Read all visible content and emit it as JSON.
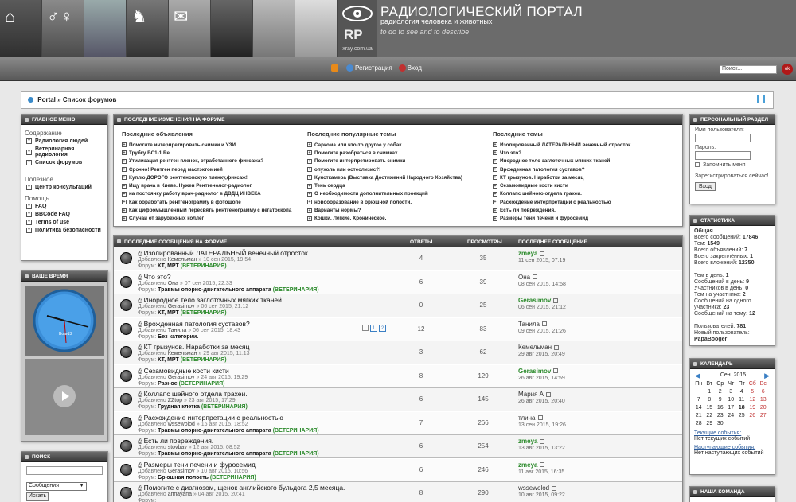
{
  "header": {
    "title": "РАДИОЛОГИЧЕСКИЙ ПОРТАЛ",
    "subtitle": "радиология человека и животных",
    "motto": "to do to see and to describe",
    "logo_text": "RP",
    "logo_url": "xray.com.ua"
  },
  "navbar": {
    "register": "Регистрация",
    "login": "Вход",
    "search_placeholder": "Поиск...",
    "search_button": "ok"
  },
  "breadcrumb": {
    "portal": "Portal",
    "sep": "»",
    "current": "Список форумов"
  },
  "left_menu": {
    "title": "ГЛАВНОЕ МЕНЮ",
    "sections": [
      {
        "head": "Содержание",
        "items": [
          "Радиология людей",
          "Ветеринарная радиология",
          "Список форумов"
        ]
      },
      {
        "head": "Полезное",
        "items": [
          "Центр консультаций"
        ]
      },
      {
        "head": "Помощь",
        "items": [
          "FAQ",
          "BBCode FAQ",
          "Terms of use",
          "Политика безопасности"
        ]
      }
    ]
  },
  "time_panel": {
    "title": "ВАШЕ ВРЕМЯ",
    "clock_brand": "Board3"
  },
  "search_panel": {
    "title": "ПОИСК",
    "select_value": "Сообщения",
    "button": "Искать"
  },
  "recent": {
    "title": "ПОСЛЕДНИЕ ИЗМЕНЕНИЯ НА ФОРУМЕ",
    "columns": [
      {
        "head": "Последние объявления",
        "items": [
          "Помогите интерпретировать снимки и УЗИ.",
          "Трубку БС1-1 Re",
          "Утилизация рентген пленок, отработанного фиксажа?",
          "Срочно! Рентген перед мастэктомией",
          "Куплю ДОРОГО рентгеновскую пленку,фиксаж!",
          "Ищу врача в Киеве. Нужен Рентгенолог-радиолог.",
          "на постоянку работу врач-радиолог в ДВДЦ ИНВЕКА",
          "Как обработать рентгенограмму в фотошопе",
          "Как цифромышленный пересвять рентгенограмму с негатоскопа",
          "Случаи от зарубежных коллег"
        ]
      },
      {
        "head": "Последние популярные темы",
        "items": [
          "Саркома или что-то другое у собак.",
          "Помогите разобраться в снимках",
          "Помогите интерпретировать снимки",
          "опухоль или остеолизис?!",
          "Кунсткамера (Выставка Достижений Народного Хозяйства)",
          "Тень сердца",
          "О необходимости дополнительных проекций",
          "новообразование в брюшной полости.",
          "Варианты нормы?",
          "Кошки. Лёгкие. Хроническое."
        ]
      },
      {
        "head": "Последние темы",
        "items": [
          "Изолированный ЛАТЕРАЛЬНЫЙ венечный отросток",
          "Что это?",
          "Инородное тело заглоточных мягких тканей",
          "Врожденная патология суставов?",
          "КТ грызунов. Наработки за месяц",
          "Сезамовидные кости кисти",
          "Коллапс шейного отдела трахеи.",
          "Расхождение интерпретации с реальностью",
          "Есть ли повреждения.",
          "Размеры тени печени и фуросемид"
        ]
      }
    ]
  },
  "messages": {
    "title": "ПОСЛЕДНИЕ СООБЩЕНИЯ НА ФОРУМЕ",
    "col_replies": "ОТВЕТЫ",
    "col_views": "ПРОСМОТРЫ",
    "col_last": "ПОСЛЕДНЕЕ СООБЩЕНИЕ",
    "rows": [
      {
        "topic": "Изолированный ЛАТЕРАЛЬНЫЙ венечный отросток",
        "added": "Добавлено",
        "author": "Кемельман",
        "date": "» 10 сен 2015, 19:54",
        "forum_label": "Форум:",
        "forum": "КТ, МРТ",
        "tag": "(ВЕТЕРИНАРИЯ)",
        "replies": "4",
        "views": "35",
        "last_user": "zmeya",
        "last_green": true,
        "last_date": "11 сен 2015, 07:19"
      },
      {
        "topic": "Что это?",
        "added": "Добавлено",
        "author": "Она",
        "date": "» 07 сен 2015, 22:33",
        "forum_label": "Форум:",
        "forum": "Травмы опорно-двигательного аппарата",
        "tag": "(ВЕТЕРИНАРИЯ)",
        "replies": "6",
        "views": "39",
        "last_user": "Она",
        "last_green": false,
        "last_date": "08 сен 2015, 14:58"
      },
      {
        "topic": "Инородное тело заглоточных мягких тканей",
        "added": "Добавлено",
        "author": "Gerasimov",
        "date": "» 06 сен 2015, 21:12",
        "forum_label": "Форум:",
        "forum": "КТ, МРТ",
        "tag": "(ВЕТЕРИНАРИЯ)",
        "replies": "0",
        "views": "25",
        "last_user": "Gerasimov",
        "last_green": true,
        "last_date": "06 сен 2015, 21:12"
      },
      {
        "topic": "Врожденная патология суставов?",
        "added": "Добавлено",
        "author": "Танила",
        "date": "» 06 сен 2015, 18:43",
        "forum_label": "Форум:",
        "forum": "Без категории.",
        "tag": "",
        "replies": "12",
        "views": "83",
        "last_user": "Танила",
        "last_green": false,
        "last_date": "09 сен 2015, 21:26",
        "pages": [
          "1",
          "2"
        ]
      },
      {
        "topic": "КТ грызунов. Наработки за месяц",
        "added": "Добавлено",
        "author": "Кемельман",
        "date": "» 29 авг 2015, 11:13",
        "forum_label": "Форум:",
        "forum": "КТ, МРТ",
        "tag": "(ВЕТЕРИНАРИЯ)",
        "replies": "3",
        "views": "62",
        "last_user": "Кемельман",
        "last_green": false,
        "last_date": "29 авг 2015, 20:49"
      },
      {
        "topic": "Сезамовидные кости кисти",
        "added": "Добавлено",
        "author": "Gerasimov",
        "date": "» 24 авг 2015, 19:29",
        "forum_label": "Форум:",
        "forum": "Разное",
        "tag": "(ВЕТЕРИНАРИЯ)",
        "replies": "8",
        "views": "129",
        "last_user": "Gerasimov",
        "last_green": true,
        "last_date": "26 авг 2015, 14:59"
      },
      {
        "topic": "Коллапс шейного отдела трахеи.",
        "added": "Добавлено",
        "author": "ZZtop",
        "date": "» 23 авг 2015, 17:29",
        "forum_label": "Форум:",
        "forum": "Грудная клетка",
        "tag": "(ВЕТЕРИНАРИЯ)",
        "replies": "6",
        "views": "145",
        "last_user": "Мария А",
        "last_green": false,
        "last_date": "26 авг 2015, 20:40"
      },
      {
        "topic": "Расхождение интерпретации с реальностью",
        "added": "Добавлено",
        "author": "wssewolod",
        "date": "» 16 авг 2015, 18:52",
        "forum_label": "Форум:",
        "forum": "Травмы опорно-двигательного аппарата",
        "tag": "(ВЕТЕРИНАРИЯ)",
        "replies": "7",
        "views": "266",
        "last_user": "тлина",
        "last_green": false,
        "last_date": "13 сен 2015, 19:26"
      },
      {
        "topic": "Есть ли повреждения.",
        "added": "Добавлено",
        "author": "stovbav",
        "date": "» 12 авг 2015, 08:52",
        "forum_label": "Форум:",
        "forum": "Травмы опорно-двигательного аппарата",
        "tag": "(ВЕТЕРИНАРИЯ)",
        "replies": "6",
        "views": "254",
        "last_user": "zmeya",
        "last_green": true,
        "last_date": "13 авг 2015, 13:22"
      },
      {
        "topic": "Размеры тени печени и фуросемид",
        "added": "Добавлено",
        "author": "Gerasimov",
        "date": "» 10 авг 2015, 10:56",
        "forum_label": "Форум:",
        "forum": "Брюшная полость",
        "tag": "(ВЕТЕРИНАРИЯ)",
        "replies": "6",
        "views": "246",
        "last_user": "zmeya",
        "last_green": true,
        "last_date": "11 авг 2015, 16:35"
      },
      {
        "topic": "Помогите с диагнозом, щенок английского бульдога 2,5 месяца.",
        "added": "Добавлено",
        "author": "аппауапа",
        "date": "» 04 авг 2015, 20:41",
        "forum_label": "Форум:",
        "forum": "",
        "tag": "",
        "replies": "8",
        "views": "290",
        "last_user": "wssewolod",
        "last_green": false,
        "last_date": "10 авг 2015, 09:22"
      }
    ]
  },
  "personal": {
    "title": "ПЕРСОНАЛЬНЫЙ РАЗДЕЛ",
    "user_label": "Имя пользователя:",
    "pass_label": "Пароль:",
    "remember": "Запомнить меня",
    "register_link": "Зарегистрироваться сейчас!",
    "login_button": "Вход"
  },
  "stats": {
    "title": "СТАТИСТИКА",
    "general_head": "Общая",
    "lines1": [
      [
        "Всего сообщений: ",
        "17846"
      ],
      [
        "Тем: ",
        "1549"
      ],
      [
        "Всего объявлений: ",
        "7"
      ],
      [
        "Всего закреплённых: ",
        "1"
      ],
      [
        "Всего вложений: ",
        "12350"
      ]
    ],
    "lines2": [
      [
        "Тем в день: ",
        "1"
      ],
      [
        "Сообщений в день: ",
        "9"
      ],
      [
        "Участников в день: ",
        "0"
      ],
      [
        "Тем на участника: ",
        "2"
      ],
      [
        "Сообщений на одного участника: ",
        "23"
      ],
      [
        "Сообщений на тему: ",
        "12"
      ]
    ],
    "users_label": "Пользователей: ",
    "users_count": "781",
    "newest_label": "Новый пользователь:",
    "newest_user": "PapaBooger"
  },
  "calendar": {
    "title": "КАЛЕНДАРЬ",
    "month": "Сен. 2015",
    "weekdays": [
      "Пн",
      "Вт",
      "Ср",
      "Чт",
      "Пт",
      "Сб",
      "Вс"
    ],
    "days": [
      "",
      "1",
      "2",
      "3",
      "4",
      "5",
      "6",
      "7",
      "8",
      "9",
      "10",
      "11",
      "12",
      "13",
      "14",
      "15",
      "16",
      "17",
      "18",
      "19",
      "20",
      "21",
      "22",
      "23",
      "24",
      "25",
      "26",
      "27",
      "28",
      "29",
      "30",
      "",
      "",
      "",
      ""
    ],
    "current_events_label": "Текущие события:",
    "current_events_value": "Нет текущих событий",
    "upcoming_label": "Наступающие события:",
    "upcoming_value": "Нет наступающих событий"
  },
  "team": {
    "title": "НАША КОМАНДА"
  }
}
